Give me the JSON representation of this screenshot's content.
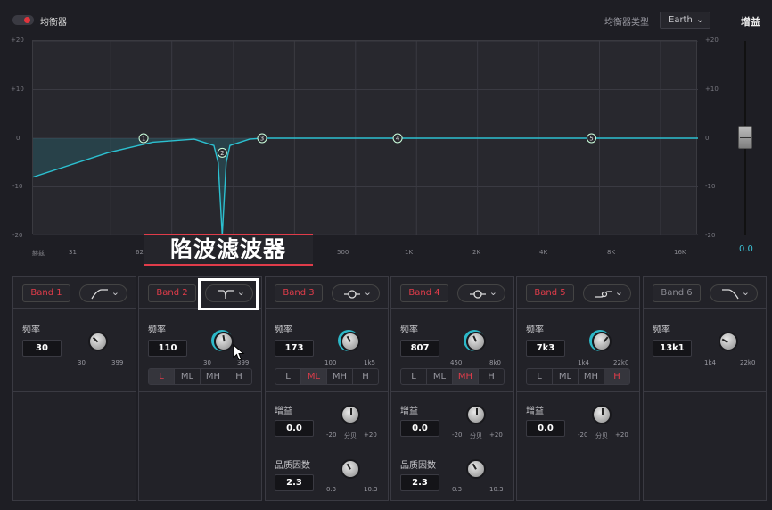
{
  "header": {
    "eq_title": "均衡器",
    "type_label": "均衡器类型",
    "type_value": "Earth",
    "gain_title": "增益"
  },
  "graph": {
    "y_left": [
      "+20",
      "+10",
      "0",
      "-10",
      "-20"
    ],
    "y_right": [
      "+20",
      "+10",
      "0",
      "-10",
      "-20"
    ],
    "x_labels": [
      "赫兹",
      "31",
      "62",
      "500",
      "1K",
      "2K",
      "4K",
      "8K",
      "16K"
    ],
    "nodes": [
      "1",
      "2",
      "3",
      "4",
      "5"
    ]
  },
  "fader": {
    "value": "0.0"
  },
  "caption": "陷波滤波器",
  "chart_data": {
    "type": "line",
    "x_unit": "Hz",
    "y_unit": "dB",
    "ylim": [
      -20,
      20
    ],
    "x": [
      20,
      30,
      50,
      80,
      100,
      105,
      110,
      115,
      120,
      150,
      173,
      807,
      7300,
      20000
    ],
    "values": [
      -8,
      -3,
      -0.8,
      -0.2,
      -1.5,
      -5,
      -20,
      -5,
      -1.5,
      -0.2,
      0,
      0,
      0,
      0
    ]
  },
  "bands": [
    {
      "label": "Band 1",
      "active": true,
      "shape": "lowcut",
      "freq_label": "频率",
      "freq": "30",
      "freq_min": "30",
      "freq_max": "399"
    },
    {
      "label": "Band 2",
      "active": true,
      "shape": "notch",
      "freq_label": "频率",
      "freq": "110",
      "freq_min": "30",
      "freq_max": "399",
      "lmh": [
        "L",
        "ML",
        "MH",
        "H"
      ],
      "lmh_sel": 0
    },
    {
      "label": "Band 3",
      "active": true,
      "shape": "bell",
      "freq_label": "频率",
      "freq": "173",
      "freq_min": "100",
      "freq_max": "1k5",
      "lmh": [
        "L",
        "ML",
        "MH",
        "H"
      ],
      "lmh_sel": 1,
      "gain_label": "增益",
      "gain": "0.0",
      "gain_min": "-20",
      "gain_unit": "分贝",
      "gain_max": "+20",
      "q_label": "品质因数",
      "q": "2.3",
      "q_min": "0.3",
      "q_max": "10.3"
    },
    {
      "label": "Band 4",
      "active": true,
      "shape": "bell",
      "freq_label": "频率",
      "freq": "807",
      "freq_min": "450",
      "freq_max": "8k0",
      "lmh": [
        "L",
        "ML",
        "MH",
        "H"
      ],
      "lmh_sel": 2,
      "gain_label": "增益",
      "gain": "0.0",
      "gain_min": "-20",
      "gain_unit": "分贝",
      "gain_max": "+20",
      "q_label": "品质因数",
      "q": "2.3",
      "q_min": "0.3",
      "q_max": "10.3"
    },
    {
      "label": "Band 5",
      "active": true,
      "shape": "shelf",
      "freq_label": "频率",
      "freq": "7k3",
      "freq_min": "1k4",
      "freq_max": "22k0",
      "lmh": [
        "L",
        "ML",
        "MH",
        "H"
      ],
      "lmh_sel": 3,
      "gain_label": "增益",
      "gain": "0.0",
      "gain_min": "-20",
      "gain_unit": "分贝",
      "gain_max": "+20"
    },
    {
      "label": "Band 6",
      "active": false,
      "shape": "highcut",
      "freq_label": "频率",
      "freq": "13k1",
      "freq_min": "1k4",
      "freq_max": "22k0"
    }
  ]
}
